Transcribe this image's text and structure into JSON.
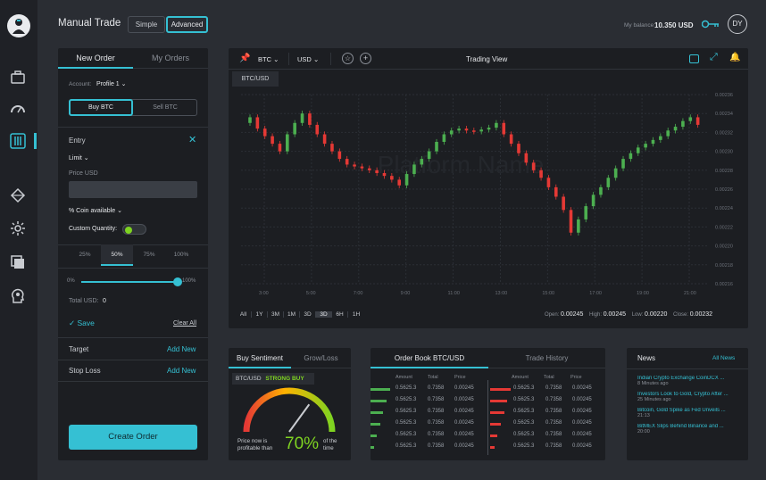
{
  "header": {
    "title": "Manual Trade",
    "mode_simple": "Simple",
    "mode_advanced": "Advanced",
    "balance_label": "My balance",
    "balance_value": "10.350 USD",
    "avatar_initials": "DY"
  },
  "order_panel": {
    "tab_new": "New Order",
    "tab_my": "My Orders",
    "account_label": "Account:",
    "account_value": "Profile 1",
    "buy_label": "Buy BTC",
    "sell_label": "Sell BTC",
    "entry_label": "Entry",
    "order_type": "Limit",
    "price_label": "Price USD",
    "coin_available": "% Coin available",
    "custom_quantity": "Custom Quantity:",
    "pct_options": [
      "25%",
      "50%",
      "75%",
      "100%"
    ],
    "slider_min": "0%",
    "slider_max": "100%",
    "slider_value": 1.0,
    "total_label": "Total USD:",
    "total_value": "0",
    "save_label": "Save",
    "clear_all": "Clear All",
    "target_label": "Target",
    "stop_loss_label": "Stop Loss",
    "add_new": "Add New",
    "create_order": "Create Order"
  },
  "chart_panel": {
    "base": "BTC",
    "quote": "USD",
    "title": "Trading View",
    "pair_tab": "BTC/USD",
    "ranges": [
      "All",
      "1Y",
      "3M",
      "1M",
      "3D",
      "1D",
      "3D",
      "6H",
      "1H"
    ],
    "active_range": "3D",
    "ohlc": {
      "open_label": "Open:",
      "open": "0.00245",
      "high_label": "High:",
      "high": "0.00245",
      "low_label": "Low:",
      "low": "0.00220",
      "close_label": "Close:",
      "close": "0.00232"
    },
    "watermark": "Platform Name"
  },
  "chart_data": {
    "type": "candlestick",
    "x_ticks": [
      "3:00",
      "5:00",
      "7:00",
      "9:00",
      "11:00",
      "13:00",
      "15:00",
      "17:00",
      "19:00",
      "21:00"
    ],
    "y_ticks": [
      "0.00236",
      "0.00234",
      "0.00232",
      "0.00230",
      "0.00228",
      "0.00226",
      "0.00224",
      "0.00222",
      "0.00220",
      "0.00218",
      "0.00216"
    ],
    "ylim": [
      0.00216,
      0.00236
    ],
    "closes": [
      0.002336,
      0.002324,
      0.002316,
      0.002308,
      0.0023,
      0.002318,
      0.00233,
      0.00234,
      0.002328,
      0.002318,
      0.002308,
      0.0023,
      0.002292,
      0.002286,
      0.002284,
      0.002282,
      0.00228,
      0.002277,
      0.002274,
      0.00227,
      0.002264,
      0.002276,
      0.002286,
      0.002292,
      0.0023,
      0.00231,
      0.002318,
      0.002322,
      0.002324,
      0.002322,
      0.002321,
      0.002323,
      0.002325,
      0.00233,
      0.002318,
      0.002308,
      0.002298,
      0.002288,
      0.00228,
      0.002272,
      0.002262,
      0.002252,
      0.002238,
      0.002214,
      0.002228,
      0.002242,
      0.002254,
      0.002262,
      0.002272,
      0.002282,
      0.002292,
      0.002298,
      0.002304,
      0.002308,
      0.002312,
      0.002316,
      0.002322,
      0.002326,
      0.002332,
      0.002336,
      0.002328
    ]
  },
  "sentiment": {
    "tab_buy": "Buy Sentiment",
    "tab_grow": "Grow/Loss",
    "pair": "BTC/USD",
    "signal": "STRONG BUY",
    "text_before": "Price now is profitable than",
    "percent": "70%",
    "percent_value": 70,
    "text_after": "of the time"
  },
  "orderbook": {
    "tab_book": "Order Book BTC/USD",
    "tab_history": "Trade History",
    "headers": [
      "Amount",
      "Total",
      "Price"
    ],
    "bids": [
      {
        "amount": "0.5625.3",
        "total": "0.7358",
        "price": "0.00245",
        "depth": 0.9
      },
      {
        "amount": "0.5625.3",
        "total": "0.7358",
        "price": "0.00245",
        "depth": 0.75
      },
      {
        "amount": "0.5625.3",
        "total": "0.7358",
        "price": "0.00245",
        "depth": 0.6
      },
      {
        "amount": "0.5625.3",
        "total": "0.7358",
        "price": "0.00245",
        "depth": 0.45
      },
      {
        "amount": "0.5625.3",
        "total": "0.7358",
        "price": "0.00245",
        "depth": 0.3
      },
      {
        "amount": "0.5625.3",
        "total": "0.7358",
        "price": "0.00245",
        "depth": 0.15
      }
    ],
    "asks": [
      {
        "amount": "0.5625.3",
        "total": "0.7358",
        "price": "0.00245",
        "depth": 0.95
      },
      {
        "amount": "0.5625.3",
        "total": "0.7358",
        "price": "0.00245",
        "depth": 0.8
      },
      {
        "amount": "0.5625.3",
        "total": "0.7358",
        "price": "0.00245",
        "depth": 0.65
      },
      {
        "amount": "0.5625.3",
        "total": "0.7358",
        "price": "0.00245",
        "depth": 0.5
      },
      {
        "amount": "0.5625.3",
        "total": "0.7358",
        "price": "0.00245",
        "depth": 0.35
      },
      {
        "amount": "0.5625.3",
        "total": "0.7358",
        "price": "0.00245",
        "depth": 0.2
      }
    ]
  },
  "news": {
    "title": "News",
    "all_news": "All News",
    "items": [
      {
        "headline": "Indian Crypto Exchange CoinDCX ...",
        "time": "8 Minutes ago"
      },
      {
        "headline": "Investors Look to Gold, Crypto After ...",
        "time": "25 Minutes ago"
      },
      {
        "headline": "Bitcoin, Gold Spike as Fed Unveils ...",
        "time": "21:13"
      },
      {
        "headline": "BitMEX Slips Behind Binance and ...",
        "time": "20:00"
      }
    ]
  },
  "colors": {
    "accent": "#35c0d3",
    "up": "#4caf50",
    "down": "#e53935",
    "bg": "#2a2d33",
    "panel": "#1c1e22"
  }
}
